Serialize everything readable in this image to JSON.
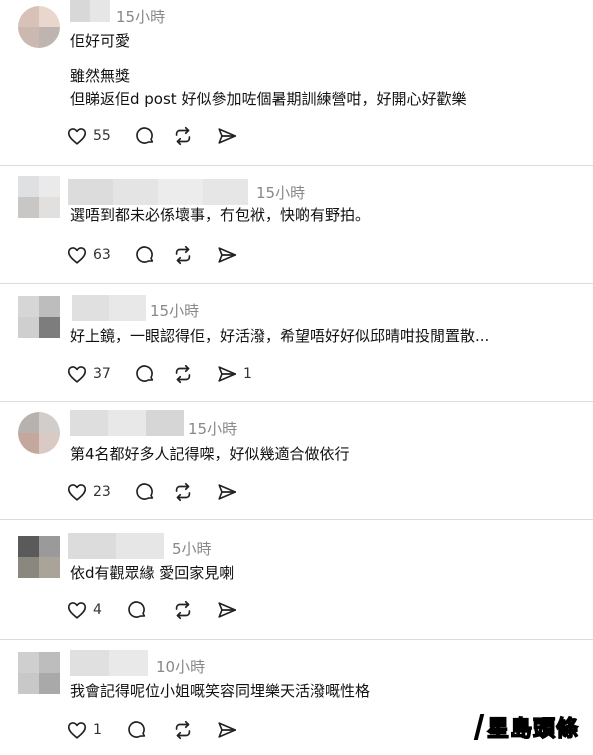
{
  "comments": [
    {
      "time": "15小時",
      "lines": [
        "佢好可愛",
        "",
        "雖然無獎",
        "但睇返佢d post 好似參加咗個暑期訓練營咁，好開心好歡樂"
      ],
      "likes": "55",
      "shares": ""
    },
    {
      "time": "15小時",
      "lines": [
        "選唔到都未必係壞事，冇包袱，快啲有野拍。"
      ],
      "likes": "63",
      "shares": ""
    },
    {
      "time": "15小時",
      "lines": [
        "好上鏡，一眼認得佢，好活潑，希望唔好好似邱晴咁投閒置散..."
      ],
      "likes": "37",
      "shares": "1"
    },
    {
      "time": "15小時",
      "lines": [
        "第4名都好多人記得㗎，好似幾適合做依行"
      ],
      "likes": "23",
      "shares": ""
    },
    {
      "time": "5小時",
      "lines": [
        "依d有觀眾緣 愛回家見喇"
      ],
      "likes": "4",
      "shares": ""
    },
    {
      "time": "10小時",
      "lines": [
        "我會記得呢位小姐嘅笑容同埋樂天活潑嘅性格"
      ],
      "likes": "1",
      "shares": ""
    }
  ],
  "icons": {
    "like": "heart-icon",
    "reply": "comment-bubble-icon",
    "repost": "repost-arrows-icon",
    "share": "send-arrow-icon"
  },
  "watermark": "星島頭條"
}
